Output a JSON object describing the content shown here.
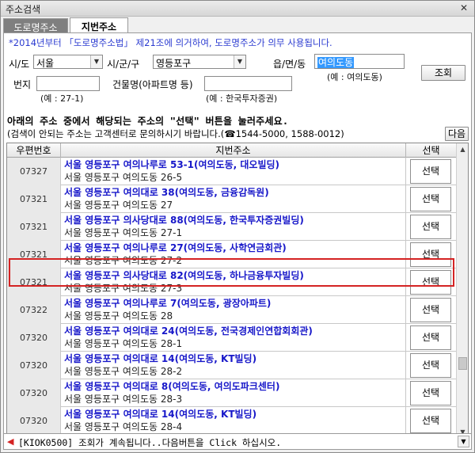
{
  "window": {
    "title": "주소검색",
    "close_glyph": "✕"
  },
  "tabs": [
    {
      "label": "도로명주소",
      "active": false
    },
    {
      "label": "지번주소",
      "active": true
    }
  ],
  "notice": "*2014년부터 「도로명주소법」 제21조에 의거하여, 도로명주소가 의무 사용됩니다.",
  "form": {
    "sido_label": "시/도",
    "sido_value": "서울",
    "sigungu_label": "시/군/구",
    "sigungu_value": "영등포구",
    "eup_label": "읍/면/동",
    "eup_value": "여의도동",
    "eup_hint": "(예 : 여의도동)",
    "beonji_label": "번지",
    "beonji_value": "",
    "beonji_hint": "(예 : 27-1)",
    "building_label": "건물명(아파트명 등)",
    "building_value": "",
    "building_hint": "(예 : 한국투자증권)",
    "search_button": "조회"
  },
  "instructions": {
    "line1": "아래의 주소 중에서 해당되는 주소의 \"선택\" 버튼을 눌러주세요.",
    "line2": "(검색이 안되는 주소는 고객센터로 문의하시기 바랍니다.(☎1544-5000, 1588-0012)",
    "next_button": "다음"
  },
  "table": {
    "headers": [
      "우편번호",
      "지번주소",
      "선택"
    ],
    "rows": [
      {
        "zip": "07327",
        "road": "서울 영등포구 여의나루로 53-1(여의도동, 대오빌딩)",
        "jibun": "서울 영등포구 여의도동   26-5",
        "select": "선택"
      },
      {
        "zip": "07321",
        "road": "서울 영등포구 여의대로 38(여의도동, 금융감독원)",
        "jibun": "서울 영등포구 여의도동   27",
        "select": "선택"
      },
      {
        "zip": "07321",
        "road": "서울 영등포구 의사당대로 88(여의도동, 한국투자증권빌딩)",
        "jibun": "서울 영등포구 여의도동   27-1",
        "select": "선택"
      },
      {
        "zip": "07321",
        "road": "서울 영등포구 여의나루로 27(여의도동, 사학연금회관)",
        "jibun": "서울 영등포구 여의도동   27-2",
        "select": "선택"
      },
      {
        "zip": "07321",
        "road": "서울 영등포구 의사당대로 82(여의도동, 하나금융투자빌딩)",
        "jibun": "서울 영등포구 여의도동   27-3",
        "select": "선택"
      },
      {
        "zip": "07322",
        "road": "서울 영등포구 여의나루로 7(여의도동, 광장아파트)",
        "jibun": "서울 영등포구 여의도동   28",
        "select": "선택"
      },
      {
        "zip": "07320",
        "road": "서울 영등포구 여의대로 24(여의도동, 전국경제인연합회회관)",
        "jibun": "서울 영등포구 여의도동   28-1",
        "select": "선택"
      },
      {
        "zip": "07320",
        "road": "서울 영등포구 여의대로 14(여의도동, KT빌딩)",
        "jibun": "서울 영등포구 여의도동   28-2",
        "select": "선택"
      },
      {
        "zip": "07320",
        "road": "서울 영등포구 여의대로 8(여의도동, 여의도파크센터)",
        "jibun": "서울 영등포구 여의도동   28-3",
        "select": "선택"
      },
      {
        "zip": "07320",
        "road": "서울 영등포구 여의대로 14(여의도동, KT빌딩)",
        "jibun": "서울 영등포구 여의도동   28-4",
        "select": "선택"
      }
    ]
  },
  "status": {
    "message": "[KIOK0500] 조회가 계속됩니다..다음버튼을 Click 하십시오."
  },
  "colors": {
    "highlight_frame": "#d42323",
    "address_link": "#1717c9",
    "notice_text": "#2a3ad0"
  }
}
